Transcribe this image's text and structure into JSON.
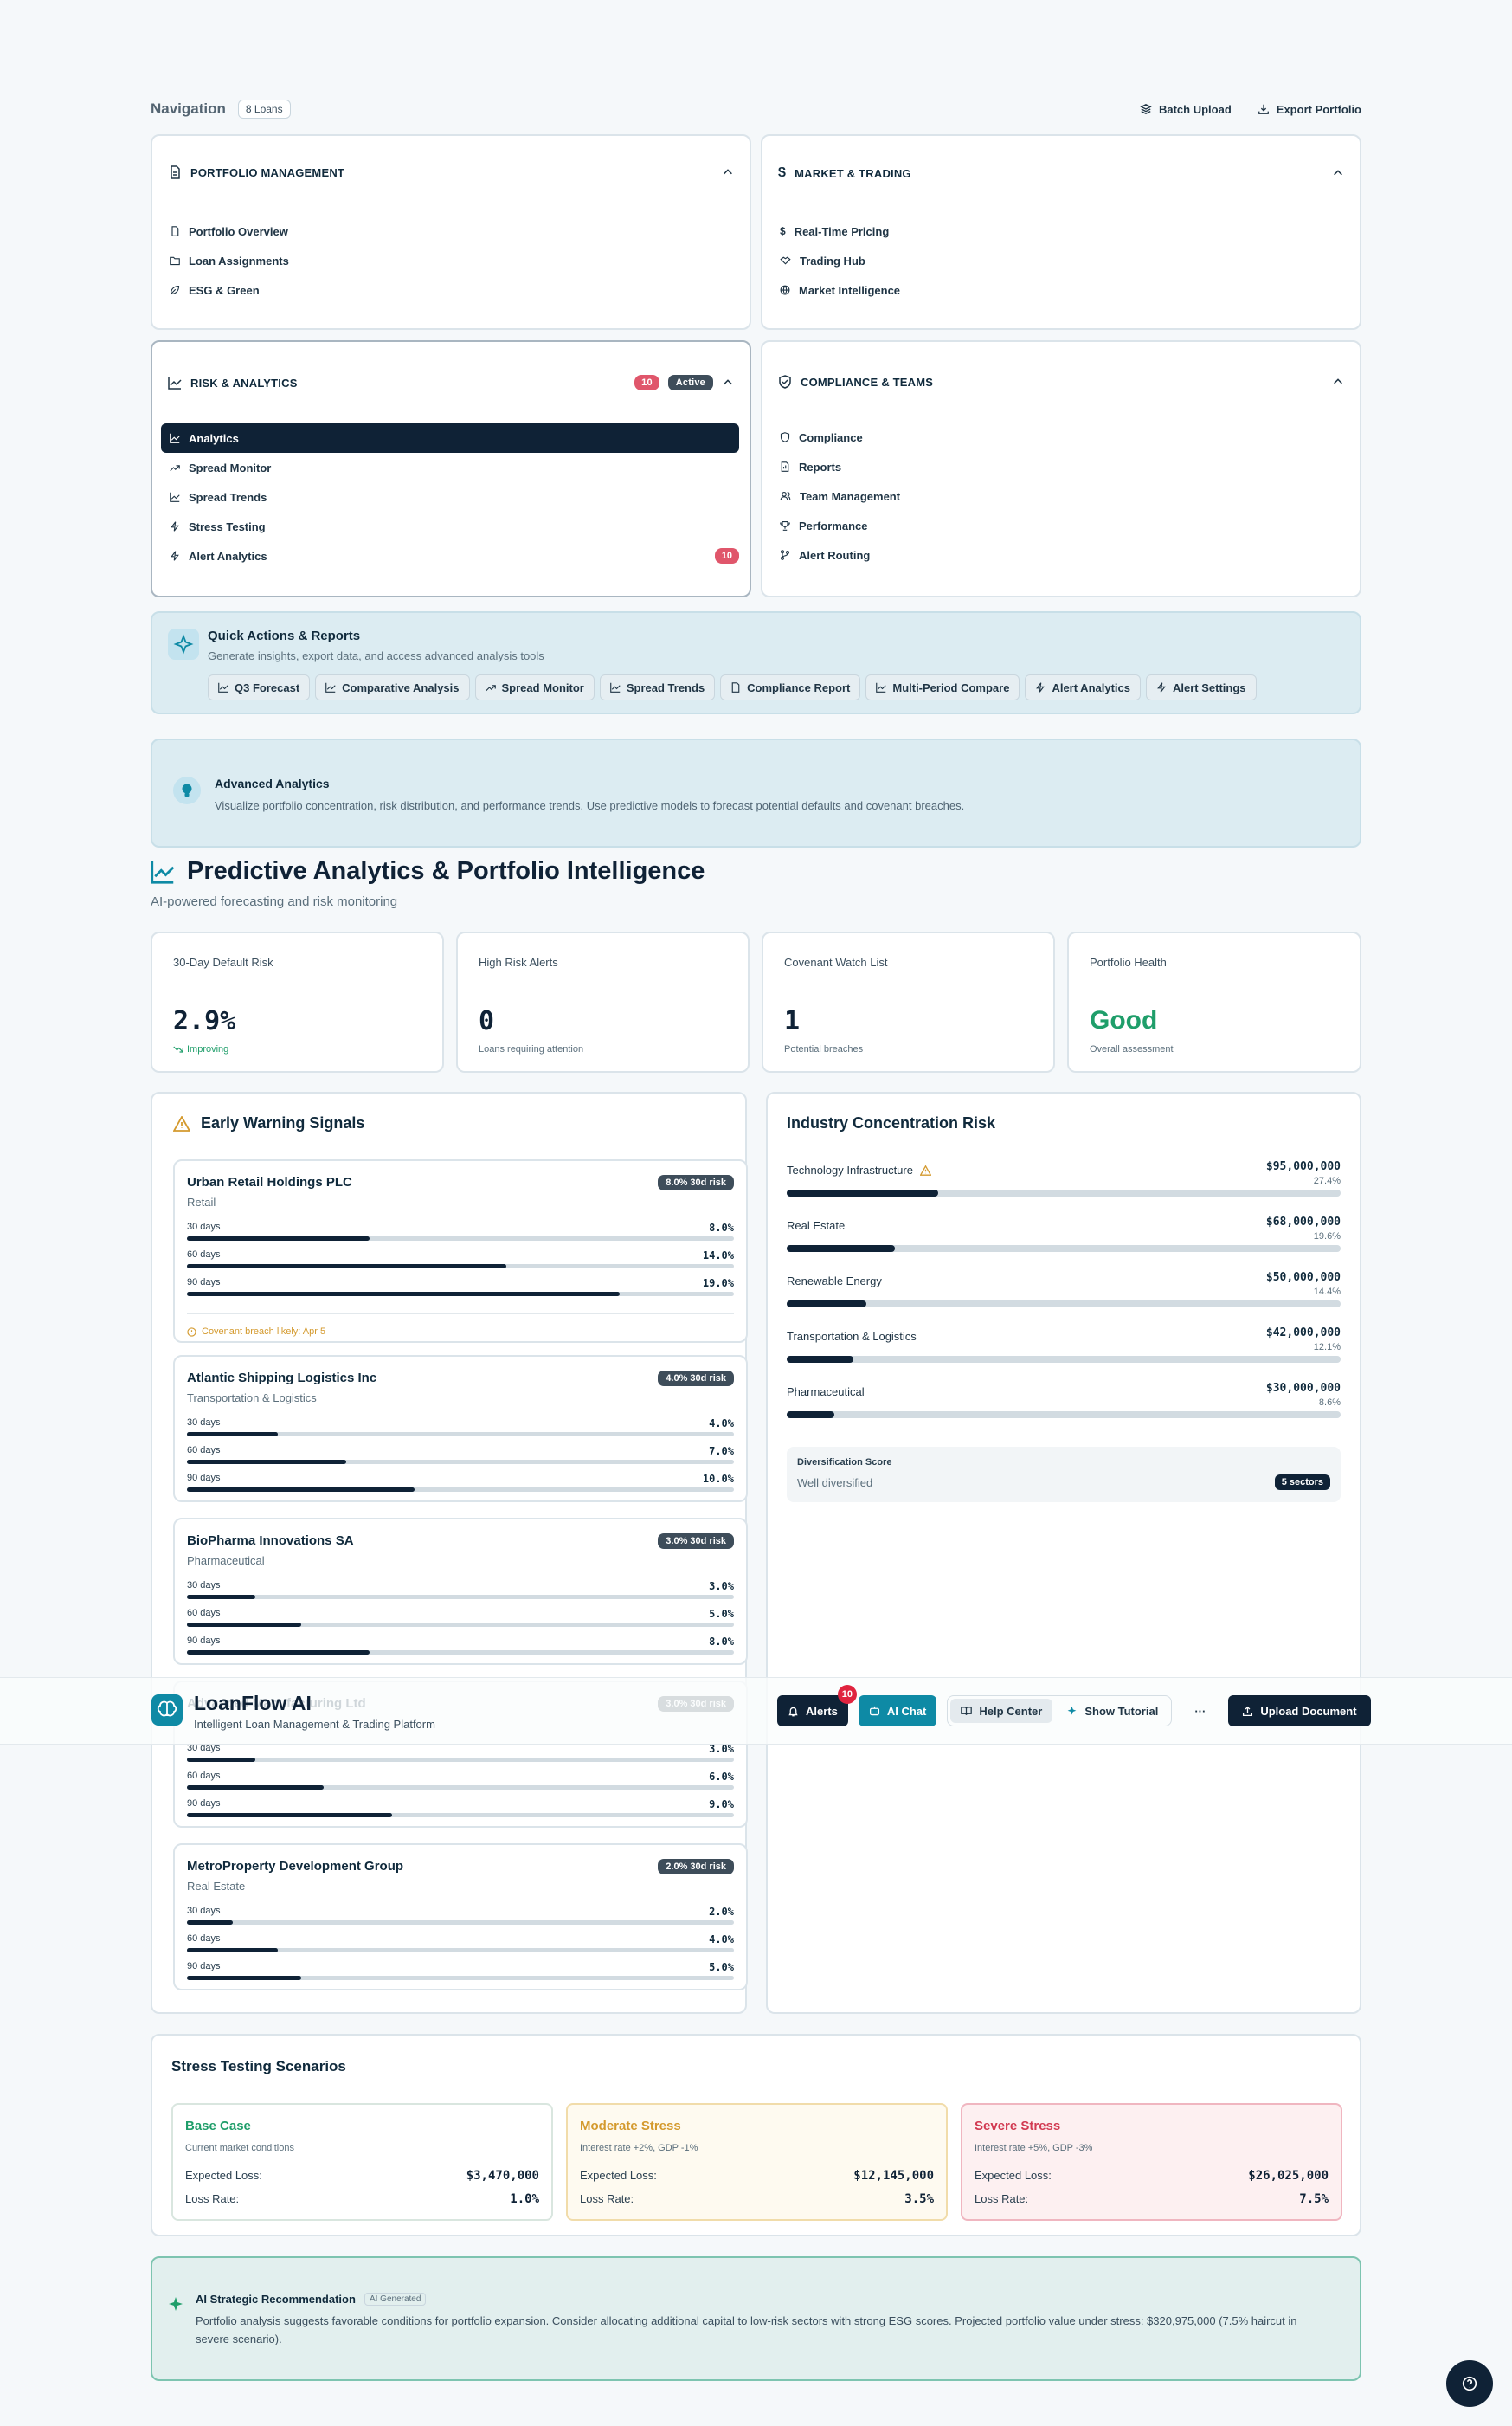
{
  "nav": {
    "title": "Navigation",
    "loan_count": "8 Loans",
    "batch_upload": "Batch Upload",
    "export_portfolio": "Export Portfolio",
    "sections": [
      {
        "title": "PORTFOLIO MANAGEMENT",
        "items": [
          "Portfolio Overview",
          "Loan Assignments",
          "ESG & Green"
        ]
      },
      {
        "title": "MARKET & TRADING",
        "items": [
          "Real-Time Pricing",
          "Trading Hub",
          "Market Intelligence"
        ]
      },
      {
        "title": "RISK & ANALYTICS",
        "badge": "10",
        "status": "Active",
        "items": [
          "Analytics",
          "Spread Monitor",
          "Spread Trends",
          "Stress Testing",
          "Alert Analytics"
        ],
        "item_badge": "10"
      },
      {
        "title": "COMPLIANCE & TEAMS",
        "items": [
          "Compliance",
          "Reports",
          "Team Management",
          "Performance",
          "Alert Routing"
        ]
      }
    ]
  },
  "quick_actions": {
    "title": "Quick Actions & Reports",
    "subtitle": "Generate insights, export data, and access advanced analysis tools",
    "chips": [
      "Q3 Forecast",
      "Comparative Analysis",
      "Spread Monitor",
      "Spread Trends",
      "Compliance Report",
      "Multi-Period Compare",
      "Alert Analytics",
      "Alert Settings"
    ]
  },
  "advanced": {
    "title": "Advanced Analytics",
    "text": "Visualize portfolio concentration, risk distribution, and performance trends. Use predictive models to forecast potential defaults and covenant breaches."
  },
  "page": {
    "title": "Predictive Analytics & Portfolio Intelligence",
    "subtitle": "AI-powered forecasting and risk monitoring"
  },
  "stats": [
    {
      "label": "30-Day Default Risk",
      "value": "2.9%",
      "note": "Improving"
    },
    {
      "label": "High Risk Alerts",
      "value": "0",
      "note": "Loans requiring attention"
    },
    {
      "label": "Covenant Watch List",
      "value": "1",
      "note": "Potential breaches"
    },
    {
      "label": "Portfolio Health",
      "value": "Good",
      "note": "Overall assessment"
    }
  ],
  "ews": {
    "title": "Early Warning Signals",
    "items": [
      {
        "name": "Urban Retail Holdings PLC",
        "sector": "Retail",
        "risk": "8.0% 30d risk",
        "d30": "8.0%",
        "d60": "14.0%",
        "d90": "19.0%",
        "f30": 8.0,
        "f60": 14.0,
        "f90": 19.0,
        "note": "Covenant breach likely: Apr 5"
      },
      {
        "name": "Atlantic Shipping Logistics Inc",
        "sector": "Transportation & Logistics",
        "risk": "4.0% 30d risk",
        "d30": "4.0%",
        "d60": "7.0%",
        "d90": "10.0%",
        "f30": 4.0,
        "f60": 7.0,
        "f90": 10.0
      },
      {
        "name": "BioPharma Innovations SA",
        "sector": "Pharmaceutical",
        "risk": "3.0% 30d risk",
        "d30": "3.0%",
        "d60": "5.0%",
        "d90": "8.0%",
        "f30": 3.0,
        "f60": 5.0,
        "f90": 8.0
      },
      {
        "name": "Advanced Manufacturing Ltd",
        "sector": "",
        "risk": "3.0% 30d risk",
        "d30": "3.0%",
        "d60": "6.0%",
        "d90": "9.0%",
        "f30": 3.0,
        "f60": 6.0,
        "f90": 9.0
      },
      {
        "name": "MetroProperty Development Group",
        "sector": "Real Estate",
        "risk": "2.0% 30d risk",
        "d30": "2.0%",
        "d60": "4.0%",
        "d90": "5.0%",
        "f30": 2.0,
        "f60": 4.0,
        "f90": 5.0
      }
    ],
    "labels": {
      "d30": "30 days",
      "d60": "60 days",
      "d90": "90 days"
    }
  },
  "industry": {
    "title": "Industry Concentration Risk",
    "items": [
      {
        "name": "Technology Infrastructure",
        "amount": "$95,000,000",
        "pct": "27.4%",
        "share": 27.4,
        "warn": true
      },
      {
        "name": "Real Estate",
        "amount": "$68,000,000",
        "pct": "19.6%",
        "share": 19.6
      },
      {
        "name": "Renewable Energy",
        "amount": "$50,000,000",
        "pct": "14.4%",
        "share": 14.4
      },
      {
        "name": "Transportation & Logistics",
        "amount": "$42,000,000",
        "pct": "12.1%",
        "share": 12.1
      },
      {
        "name": "Pharmaceutical",
        "amount": "$30,000,000",
        "pct": "8.6%",
        "share": 8.6
      }
    ],
    "div_label": "Diversification Score",
    "div_text": "Well diversified",
    "div_badge": "5 sectors"
  },
  "appbar": {
    "brand": "LoanFlow AI",
    "tagline": "Intelligent Loan Management & Trading Platform",
    "alerts": "Alerts",
    "alerts_count": "10",
    "ai_chat": "AI Chat",
    "help_center": "Help Center",
    "show_tutorial": "Show Tutorial",
    "more": "···",
    "upload": "Upload Document"
  },
  "stress": {
    "title": "Stress Testing Scenarios",
    "expected_loss_label": "Expected Loss:",
    "loss_rate_label": "Loss Rate:",
    "scenarios": [
      {
        "name": "Base Case",
        "desc": "Current market conditions",
        "loss": "$3,470,000",
        "rate": "1.0%"
      },
      {
        "name": "Moderate Stress",
        "desc": "Interest rate +2%, GDP -1%",
        "loss": "$12,145,000",
        "rate": "3.5%"
      },
      {
        "name": "Severe Stress",
        "desc": "Interest rate +5%, GDP -3%",
        "loss": "$26,025,000",
        "rate": "7.5%"
      }
    ]
  },
  "ai_rec": {
    "title": "AI Strategic Recommendation",
    "tag": "AI Generated",
    "text": "Portfolio analysis suggests favorable conditions for portfolio expansion. Consider allocating additional capital to low-risk sectors with strong ESG scores. Projected portfolio value under stress: $320,975,000 (7.5% haircut in severe scenario)."
  },
  "colors": {
    "accent": "#0e8aa5",
    "navy": "#0f2236",
    "good": "#1f9e6a",
    "warn": "#d49a2e",
    "danger": "#d23a52"
  }
}
